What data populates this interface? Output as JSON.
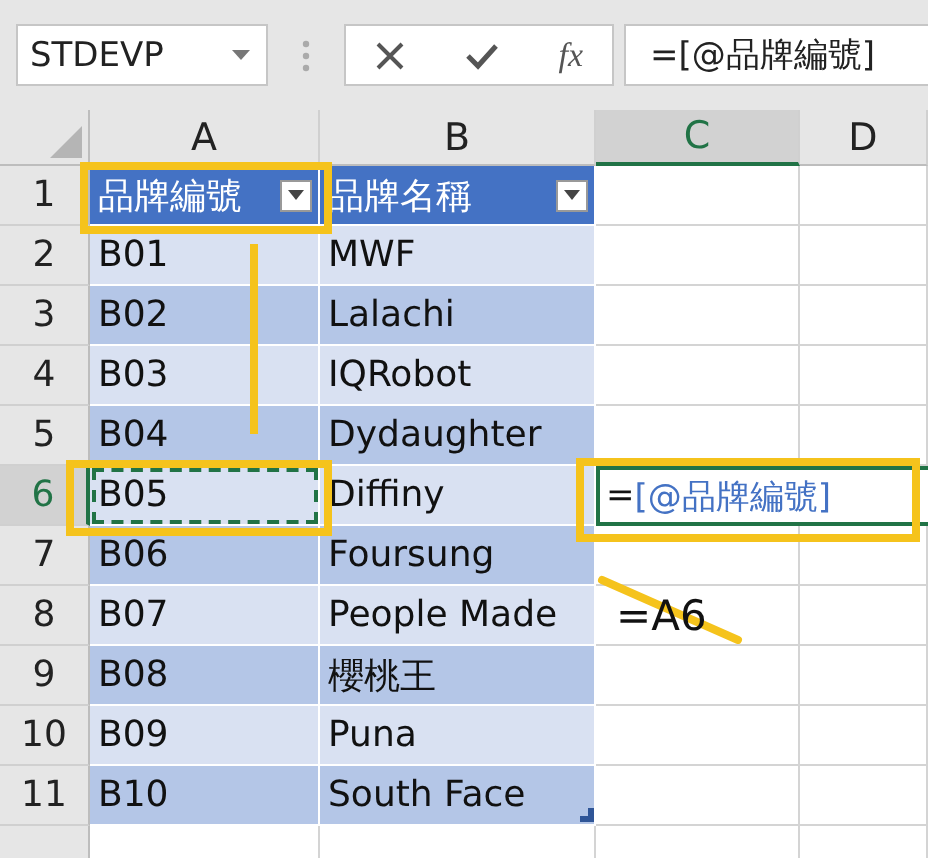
{
  "name_box": {
    "value": "STDEVP"
  },
  "formula_bar": {
    "function_label": "fx",
    "value": "=[@品牌編號]"
  },
  "columns": [
    {
      "label": "A",
      "selected": false
    },
    {
      "label": "B",
      "selected": false
    },
    {
      "label": "C",
      "selected": true
    },
    {
      "label": "D",
      "selected": false
    }
  ],
  "row_headers": [
    {
      "label": "1",
      "selected": false
    },
    {
      "label": "2",
      "selected": false
    },
    {
      "label": "3",
      "selected": false
    },
    {
      "label": "4",
      "selected": false
    },
    {
      "label": "5",
      "selected": false
    },
    {
      "label": "6",
      "selected": true
    },
    {
      "label": "7",
      "selected": false
    },
    {
      "label": "8",
      "selected": false
    },
    {
      "label": "9",
      "selected": false
    },
    {
      "label": "10",
      "selected": false
    },
    {
      "label": "11",
      "selected": false
    }
  ],
  "table": {
    "headers": [
      "品牌編號",
      "品牌名稱"
    ],
    "rows": [
      {
        "cells": [
          {
            "text": "B01",
            "copied": false
          },
          {
            "text": "MWF",
            "copied": false
          }
        ]
      },
      {
        "cells": [
          {
            "text": "B02",
            "copied": false
          },
          {
            "text": "Lalachi",
            "copied": false
          }
        ]
      },
      {
        "cells": [
          {
            "text": "B03",
            "copied": false
          },
          {
            "text": "IQRobot",
            "copied": false
          }
        ]
      },
      {
        "cells": [
          {
            "text": "B04",
            "copied": false
          },
          {
            "text": "Dydaughter",
            "copied": false
          }
        ]
      },
      {
        "cells": [
          {
            "text": "B05",
            "copied": true
          },
          {
            "text": "Diffiny",
            "copied": false
          }
        ]
      },
      {
        "cells": [
          {
            "text": "B06",
            "copied": false
          },
          {
            "text": "Foursung",
            "copied": false
          }
        ]
      },
      {
        "cells": [
          {
            "text": "B07",
            "copied": false
          },
          {
            "text": "People Made",
            "copied": false
          }
        ]
      },
      {
        "cells": [
          {
            "text": "B08",
            "copied": false
          },
          {
            "text": "櫻桃王",
            "copied": false
          }
        ]
      },
      {
        "cells": [
          {
            "text": "B09",
            "copied": false
          },
          {
            "text": "Puna",
            "copied": false
          }
        ]
      },
      {
        "cells": [
          {
            "text": "B10",
            "copied": false
          },
          {
            "text": "South Face",
            "copied": false
          }
        ]
      }
    ]
  },
  "editing_cell": {
    "prefix": "=",
    "reference": "[@品牌編號]"
  },
  "annotation": {
    "text": "=A6",
    "struck": true
  }
}
